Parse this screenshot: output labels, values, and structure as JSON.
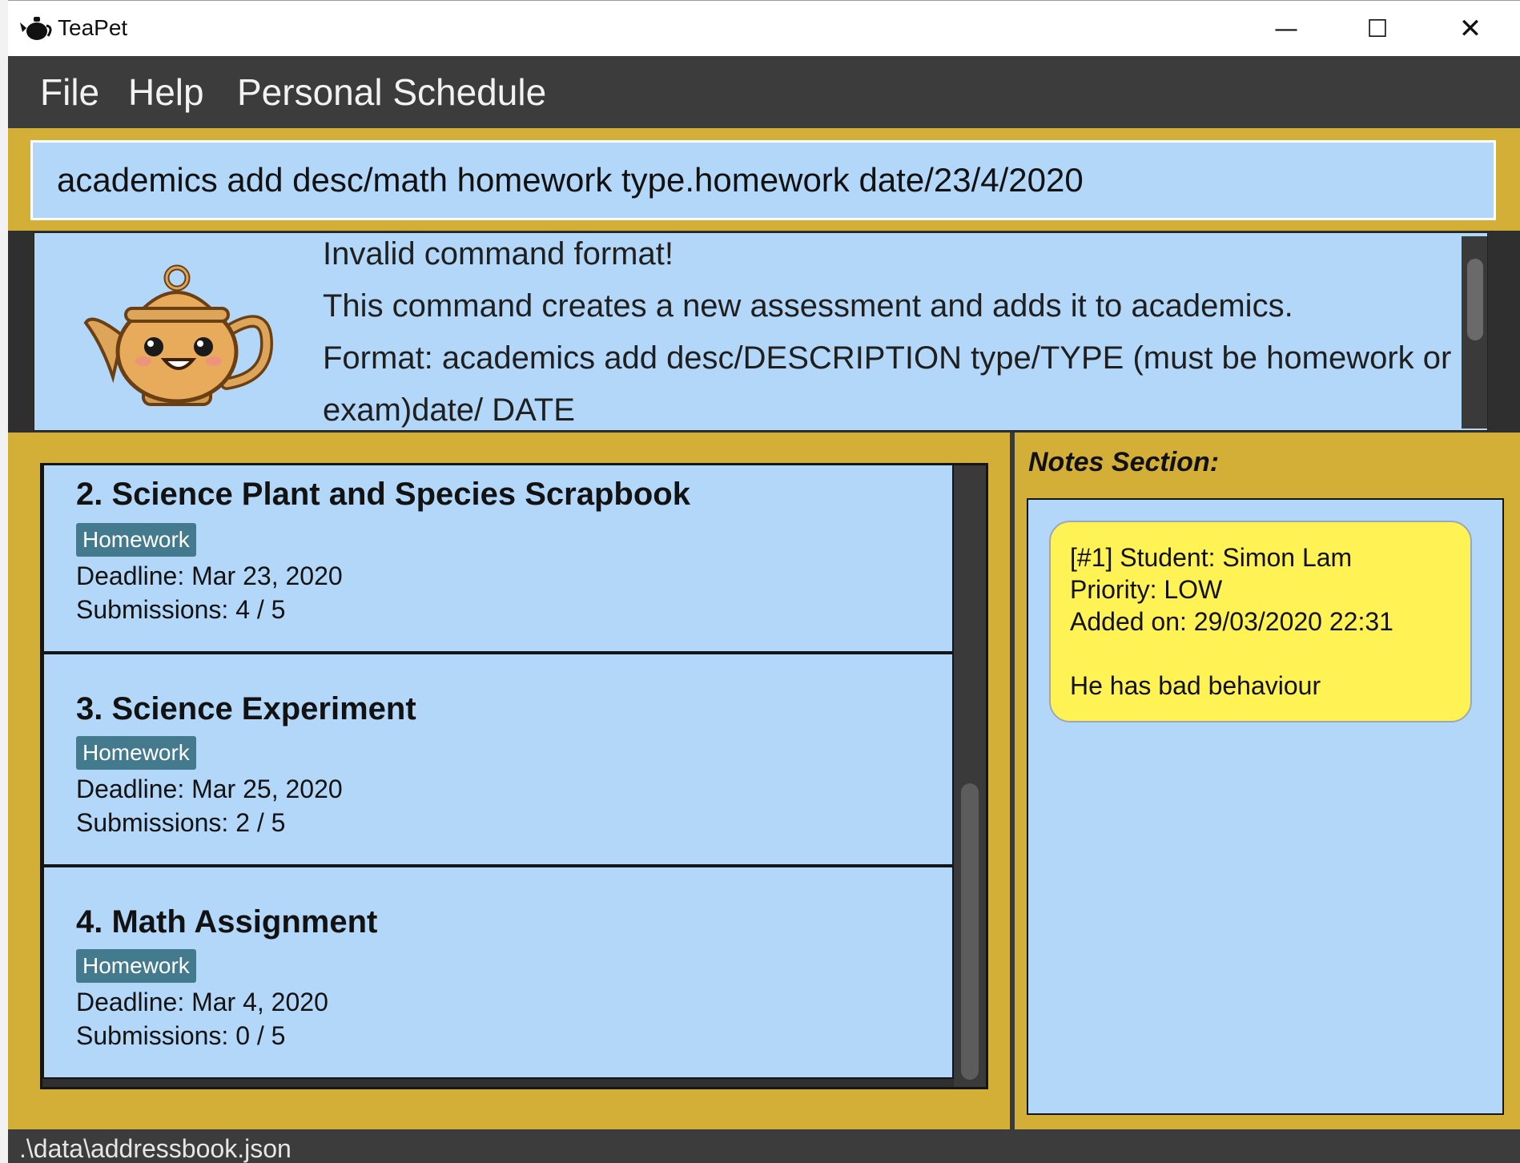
{
  "window": {
    "title": "TeaPet",
    "controls": {
      "minimize": "—",
      "maximize": "☐",
      "close": "✕"
    }
  },
  "menu": {
    "items": [
      "File",
      "Help",
      "Personal Schedule"
    ]
  },
  "command_box": {
    "value": "academics add desc/math homework type.homework date/23/4/2020"
  },
  "result_display": {
    "lines": [
      "Invalid command format!",
      "This command creates a new assessment and adds it to academics.",
      "Format: academics add desc/DESCRIPTION type/TYPE (must be homework or exam)date/ DATE"
    ]
  },
  "assessment_list": {
    "items": [
      {
        "title": "2.  Science Plant and Species Scrapbook",
        "tag": "Homework",
        "deadline": "Deadline: Mar 23, 2020",
        "submissions": "Submissions: 4 / 5"
      },
      {
        "title": "3.  Science Experiment",
        "tag": "Homework",
        "deadline": "Deadline: Mar 25, 2020",
        "submissions": "Submissions: 2 / 5"
      },
      {
        "title": "4.  Math Assignment",
        "tag": "Homework",
        "deadline": "Deadline: Mar 4, 2020",
        "submissions": "Submissions: 0 / 5"
      }
    ]
  },
  "notes": {
    "section_title": "Notes Section:",
    "cards": [
      {
        "text": "[#1] Student: Simon Lam\nPriority: LOW\nAdded on: 29/03/2020 22:31\n\nHe has bad behaviour"
      }
    ]
  },
  "status_bar": {
    "path": ".\\data\\addressbook.json"
  },
  "colors": {
    "accent_gold": "#d4af37",
    "panel_blue": "#b3d7f9",
    "menubar_dark": "#3c3c3c",
    "tag_teal": "#447a8d",
    "note_yellow": "#fff255"
  },
  "icons": [
    "teapot-app-icon",
    "teapot-mascot"
  ]
}
